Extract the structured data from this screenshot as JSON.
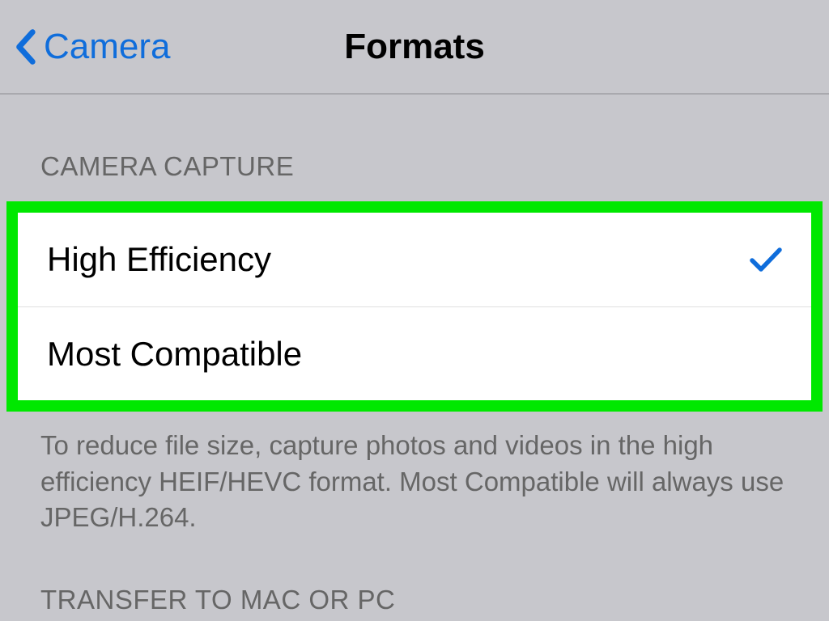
{
  "navbar": {
    "back_label": "Camera",
    "title": "Formats"
  },
  "sections": {
    "camera_capture": {
      "header": "CAMERA CAPTURE",
      "options": {
        "high_efficiency": {
          "label": "High Efficiency",
          "selected": true
        },
        "most_compatible": {
          "label": "Most Compatible",
          "selected": false
        }
      },
      "footer": "To reduce file size, capture photos and videos in the high efficiency HEIF/HEVC format. Most Compatible will always use JPEG/H.264."
    },
    "transfer": {
      "header": "TRANSFER TO MAC OR PC"
    }
  }
}
